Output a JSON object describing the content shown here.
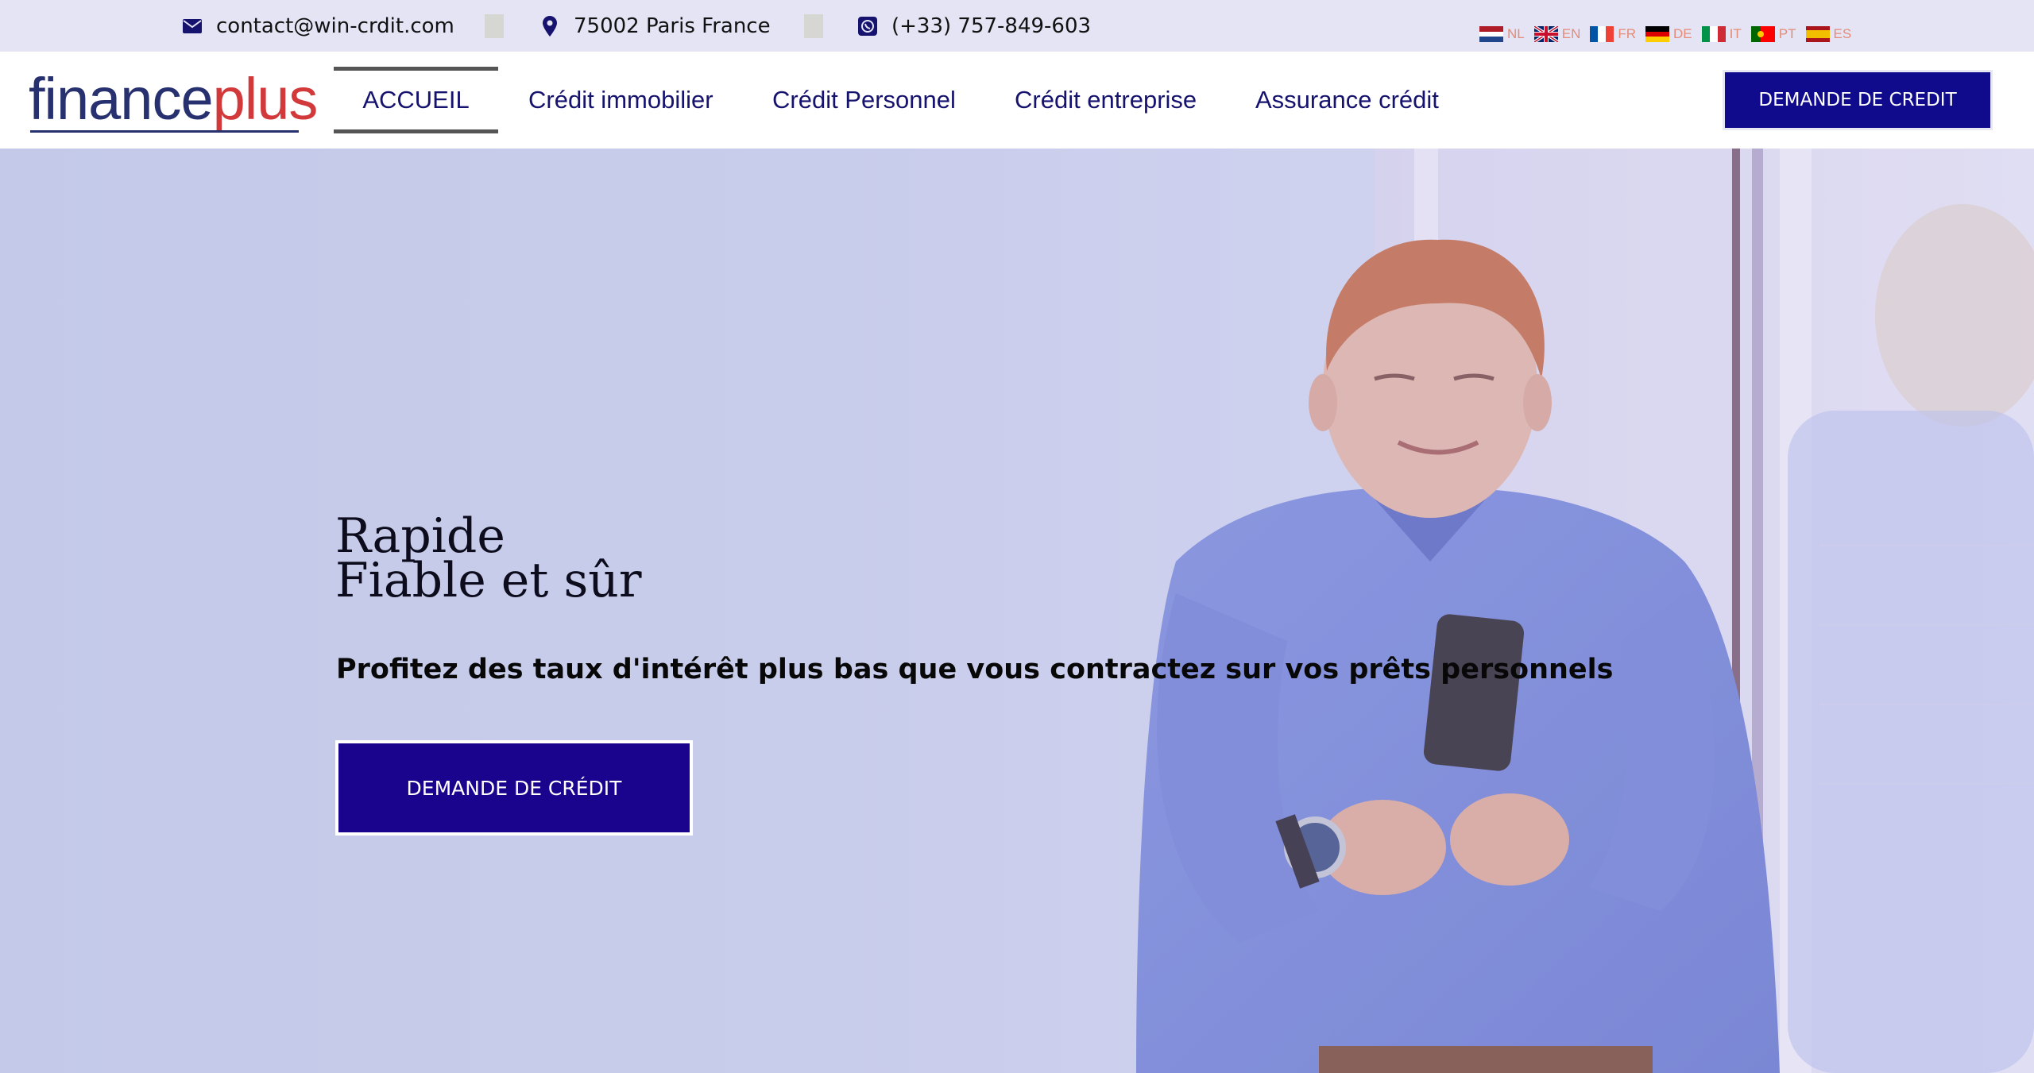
{
  "topbar": {
    "email": "contact@win-crdit.com",
    "address": "75002 Paris France",
    "phone": "(+33) 757-849-603",
    "languages": [
      {
        "code": "NL",
        "icon": "flag-nl-icon"
      },
      {
        "code": "EN",
        "icon": "flag-en-icon"
      },
      {
        "code": "FR",
        "icon": "flag-fr-icon"
      },
      {
        "code": "DE",
        "icon": "flag-de-icon"
      },
      {
        "code": "IT",
        "icon": "flag-it-icon"
      },
      {
        "code": "PT",
        "icon": "flag-pt-icon"
      },
      {
        "code": "ES",
        "icon": "flag-es-icon"
      }
    ]
  },
  "header": {
    "logo_part1": "finance",
    "logo_part2": "plus",
    "nav": [
      "ACCUEIL",
      "Crédit immobilier",
      "Crédit Personnel",
      "Crédit entreprise",
      "Assurance crédit"
    ],
    "cta": "DEMANDE DE CREDIT"
  },
  "hero": {
    "title_line1": "Rapide",
    "title_line2": "Fiable et sûr",
    "subtitle": "Profitez des taux d'intérêt plus bas que vous contractez sur vos prêts personnels",
    "cta": "DEMANDE DE CRÉDIT"
  },
  "colors": {
    "topbar_bg": "#e4e4f5",
    "nav_text": "#16136f",
    "cta_bg": "#100b8d",
    "hero_cta_bg": "#1b048d",
    "logo_blue": "#27316f",
    "logo_red": "#d2393b"
  }
}
